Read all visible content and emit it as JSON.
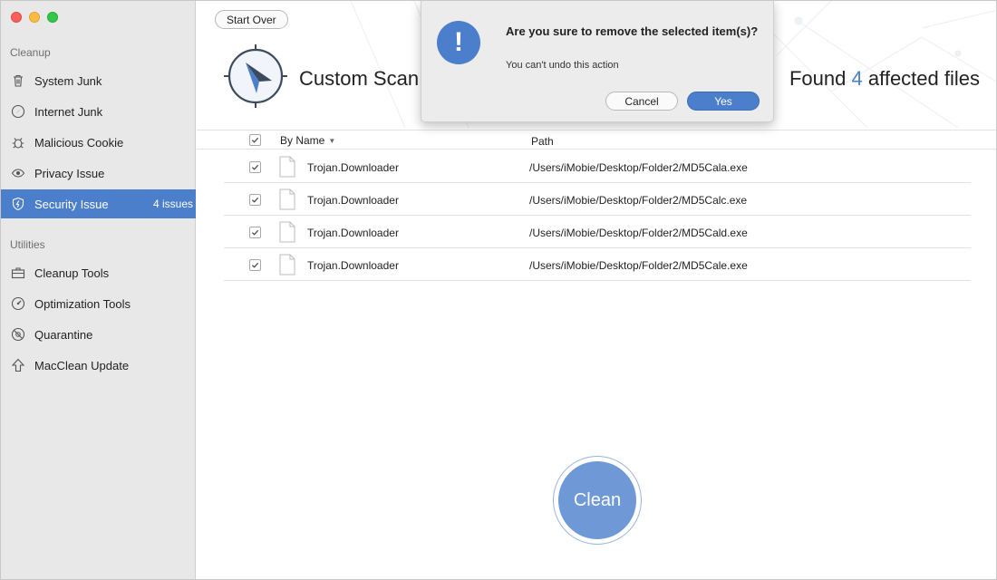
{
  "sidebar": {
    "cleanup_label": "Cleanup",
    "utilities_label": "Utilities",
    "cleanup_items": [
      {
        "label": "System Junk",
        "icon": "trash-icon"
      },
      {
        "label": "Internet Junk",
        "icon": "compass-icon"
      },
      {
        "label": "Malicious Cookie",
        "icon": "bug-icon"
      },
      {
        "label": "Privacy Issue",
        "icon": "eye-icon"
      },
      {
        "label": "Security Issue",
        "icon": "shield-icon",
        "badge": "4 issues",
        "active": true
      }
    ],
    "utility_items": [
      {
        "label": "Cleanup Tools",
        "icon": "toolbox-icon"
      },
      {
        "label": "Optimization Tools",
        "icon": "gauge-icon"
      },
      {
        "label": "Quarantine",
        "icon": "quarantine-icon"
      },
      {
        "label": "MacClean Update",
        "icon": "upload-arrow-icon"
      }
    ]
  },
  "header": {
    "start_over": "Start Over",
    "scan_title": "Custom Scan",
    "found_prefix": "Found",
    "found_count": "4",
    "found_suffix": "affected files"
  },
  "table": {
    "col_name": "By Name",
    "col_path": "Path",
    "rows": [
      {
        "name": "Trojan.Downloader",
        "path": "/Users/iMobie/Desktop/Folder2/MD5Cala.exe",
        "checked": true
      },
      {
        "name": "Trojan.Downloader",
        "path": "/Users/iMobie/Desktop/Folder2/MD5Calc.exe",
        "checked": true
      },
      {
        "name": "Trojan.Downloader",
        "path": "/Users/iMobie/Desktop/Folder2/MD5Cald.exe",
        "checked": true
      },
      {
        "name": "Trojan.Downloader",
        "path": "/Users/iMobie/Desktop/Folder2/MD5Cale.exe",
        "checked": true
      }
    ]
  },
  "clean_button": "Clean",
  "dialog": {
    "icon": "exclamation-icon",
    "message": "Are you sure to remove the selected item(s)?",
    "sub": "You can't undo this action",
    "cancel": "Cancel",
    "yes": "Yes"
  },
  "colors": {
    "accent": "#4b7fcb",
    "clean_button": "#6f98d6",
    "sidebar_bg": "#e8e8e8",
    "dialog_bg": "#ececec"
  }
}
